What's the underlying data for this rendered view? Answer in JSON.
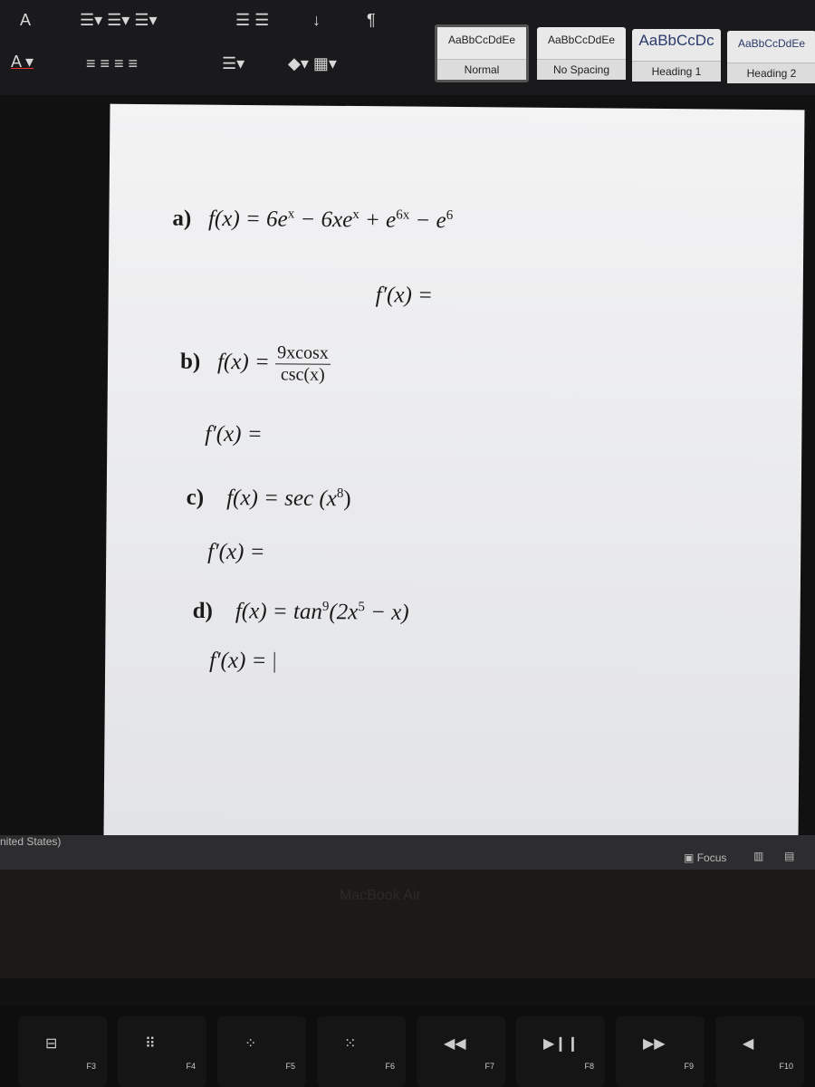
{
  "toolbar": {
    "styles": [
      {
        "preview": "AaBbCcDdEe",
        "name": "Normal",
        "selected": true
      },
      {
        "preview": "AaBbCcDdEe",
        "name": "No Spacing"
      },
      {
        "preview": "AaBbCcDc",
        "name": "Heading 1"
      },
      {
        "preview": "AaBbCcDdEe",
        "name": "Heading 2"
      }
    ]
  },
  "document": {
    "a": {
      "label": "a)",
      "fx": "f(x) = 6e",
      "e1": "x",
      "t2": " − 6xe",
      "e2": "x",
      "t3": " + e",
      "e3": "6x",
      "t4": " − e",
      "e4": "6",
      "deriv": "f′(x) ="
    },
    "b": {
      "label": "b)",
      "fx": "f(x) =",
      "num": "9xcosx",
      "den": "csc(x)",
      "deriv": "f′(x) ="
    },
    "c": {
      "label": "c)",
      "fx": "f(x) = sec (x",
      "e1": "8",
      "close": ")",
      "deriv": "f′(x) ="
    },
    "d": {
      "label": "d)",
      "fx": "f(x) = tan",
      "e1": "9",
      "mid": "(2x",
      "e2": "5",
      "end": " − x)",
      "deriv": "f′(x) ="
    }
  },
  "status": {
    "language": "nited States)",
    "focus": "Focus"
  },
  "bezel": {
    "brand": "MacBook Air"
  },
  "keyboard": {
    "keys": [
      "F3",
      "F4",
      "F5",
      "F6",
      "F7",
      "F8",
      "F9",
      "F10"
    ]
  }
}
